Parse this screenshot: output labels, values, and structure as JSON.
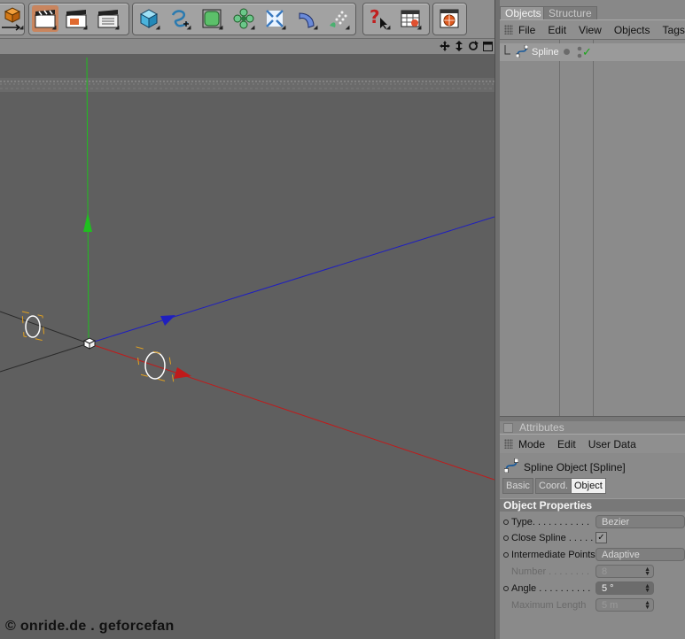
{
  "viewport": {
    "watermark": "© onride.de . geforcefan"
  },
  "toolbar": {
    "groups": [
      {
        "buttons": [
          "cube-move-icon"
        ]
      },
      {
        "buttons": [
          "clapper-render-icon",
          "clapper-render-view-icon",
          "clapper-render-settings-icon"
        ]
      },
      {
        "buttons": [
          "cube-icon",
          "spline-pen-icon",
          "subdivision-cube-icon",
          "array-flower-icon",
          "deformer-icon",
          "nurbs-extrude-icon",
          "particle-icon"
        ]
      },
      {
        "buttons": [
          "help-question-icon",
          "timeline-table-icon"
        ]
      },
      {
        "buttons": [
          "sphere-window-icon"
        ]
      }
    ]
  },
  "objects_panel": {
    "tabs": [
      "Objects",
      "Structure"
    ],
    "menu": [
      "File",
      "Edit",
      "View",
      "Objects",
      "Tags"
    ],
    "object_name": "Spline"
  },
  "attributes_panel": {
    "title": "Attributes",
    "menu": [
      "Mode",
      "Edit",
      "User Data"
    ],
    "object_title": "Spline Object [Spline]",
    "tabs": [
      "Basic",
      "Coord.",
      "Object"
    ],
    "section_title": "Object Properties",
    "properties": {
      "type_label": "Type. . . . . . . . . . .",
      "type_value": "Bezier",
      "close_label": "Close Spline . . . . .",
      "close_checked": "✓",
      "intermediate_label": "Intermediate Points",
      "intermediate_value": "Adaptive",
      "number_label": "Number . . . . . . . .",
      "number_value": "8",
      "angle_label": "Angle . . . . . . . . . .",
      "angle_value": "5 °",
      "maxlen_label": "Maximum Length",
      "maxlen_value": "5 m"
    }
  }
}
